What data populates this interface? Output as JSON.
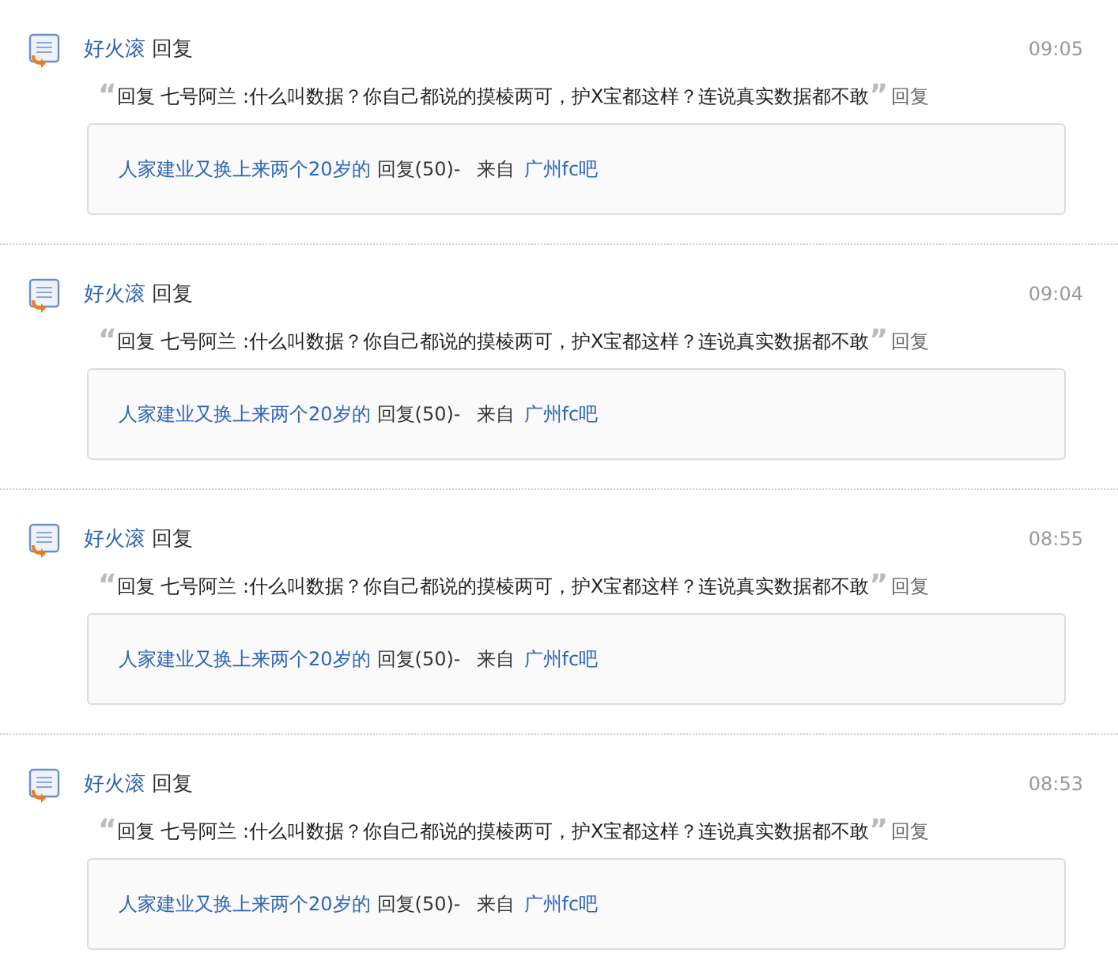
{
  "items": [
    {
      "user": "好火滚",
      "action": "回复",
      "time": "09:05",
      "open_quote": "“",
      "quote": "回复 七号阿兰 :什么叫数据？你自己都说的摸棱两可，护X宝都这样？连说真实数据都不敢",
      "close_quote": "”",
      "quote_action": "回复",
      "thread_title": "人家建业又换上来两个20岁的",
      "thread_reply": "回复(50)-",
      "from_label": "来自",
      "forum": "广州fc吧"
    },
    {
      "user": "好火滚",
      "action": "回复",
      "time": "09:04",
      "open_quote": "“",
      "quote": "回复 七号阿兰 :什么叫数据？你自己都说的摸棱两可，护X宝都这样？连说真实数据都不敢",
      "close_quote": "”",
      "quote_action": "回复",
      "thread_title": "人家建业又换上来两个20岁的",
      "thread_reply": "回复(50)-",
      "from_label": "来自",
      "forum": "广州fc吧"
    },
    {
      "user": "好火滚",
      "action": "回复",
      "time": "08:55",
      "open_quote": "“",
      "quote": "回复 七号阿兰 :什么叫数据？你自己都说的摸棱两可，护X宝都这样？连说真实数据都不敢",
      "close_quote": "”",
      "quote_action": "回复",
      "thread_title": "人家建业又换上来两个20岁的",
      "thread_reply": "回复(50)-",
      "from_label": "来自",
      "forum": "广州fc吧"
    },
    {
      "user": "好火滚",
      "action": "回复",
      "time": "08:53",
      "open_quote": "“",
      "quote": "回复 七号阿兰 :什么叫数据？你自己都说的摸棱两可，护X宝都这样？连说真实数据都不敢",
      "close_quote": "”",
      "quote_action": "回复",
      "thread_title": "人家建业又换上来两个20岁的",
      "thread_reply": "回复(50)-",
      "from_label": "来自",
      "forum": "广州fc吧"
    }
  ]
}
